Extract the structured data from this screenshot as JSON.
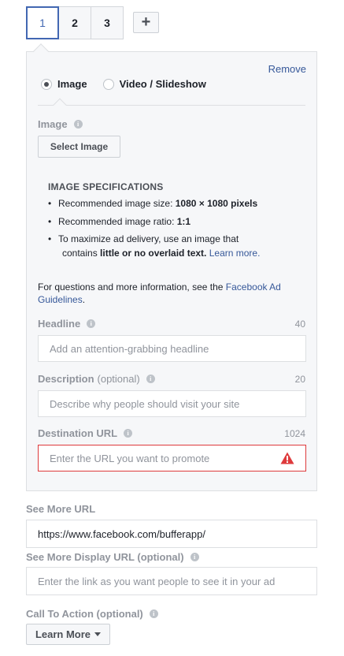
{
  "cards": {
    "tabs": [
      "1",
      "2",
      "3"
    ],
    "add_icon": "plus-icon",
    "add_glyph": "+"
  },
  "panel": {
    "remove_label": "Remove",
    "media_options": [
      "Image",
      "Video / Slideshow"
    ],
    "selected_media": "Image",
    "image": {
      "label": "Image",
      "select_button": "Select Image"
    },
    "specs": {
      "title": "IMAGE SPECIFICATIONS",
      "size_text": "Recommended image size: ",
      "size_value": "1080 × 1080 pixels",
      "ratio_text": "Recommended image ratio: ",
      "ratio_value": "1:1",
      "delivery_text": "To maximize ad delivery, use an image that",
      "delivery_text2_prefix": "contains ",
      "delivery_text2_bold": "little or no overlaid text.",
      "learn_more": "Learn more."
    },
    "info_text": "For questions and more information, see the ",
    "info_link": "Facebook Ad Guidelines",
    "info_end": ".",
    "headline": {
      "label": "Headline",
      "count": "40",
      "placeholder": "Add an attention-grabbing headline"
    },
    "description": {
      "label": "Description",
      "optional": "(optional)",
      "count": "20",
      "placeholder": "Describe why people should visit your site"
    },
    "destination": {
      "label": "Destination URL",
      "count": "1024",
      "placeholder": "Enter the URL you want to promote",
      "error_color": "#de3a3c"
    }
  },
  "see_more": {
    "label": "See More URL",
    "value": "https://www.facebook.com/bufferapp/"
  },
  "see_more_display": {
    "label": "See More Display URL (optional)",
    "placeholder": "Enter the link as you want people to see it in your ad"
  },
  "cta": {
    "label": "Call To Action (optional)",
    "value": "Learn More"
  },
  "colors": {
    "accent": "#4267b2",
    "link": "#365899",
    "muted": "#90949c"
  }
}
